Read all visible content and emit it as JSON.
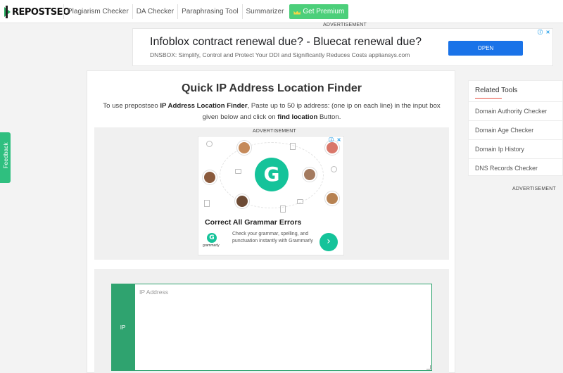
{
  "header": {
    "logo_text": "REPOSTSEO",
    "nav": [
      "Plagiarism Checker",
      "DA Checker",
      "Paraphrasing Tool",
      "Summarizer"
    ],
    "premium_label": "Get Premium"
  },
  "top_ad": {
    "label": "ADVERTISEMENT",
    "title": "Infoblox contract renewal due? - Bluecat renewal due?",
    "description": "DNSBOX: Simplify, Control and Protect Your DDI and Significantly Reduces Costs appliansys.com",
    "button": "OPEN",
    "button_color": "#1a73e8"
  },
  "main": {
    "title": "Quick IP Address Location Finder",
    "desc_1": "To use prepostseo ",
    "desc_bold_1": "IP Address Location Finder",
    "desc_2": ", Paste up to 50 ip address: (one ip on each line) in the input box given below and click on ",
    "desc_bold_2": "find location",
    "desc_3": " Button."
  },
  "mid_ad": {
    "label": "ADVERTISEMENT",
    "headline": "Correct All Grammar Errors",
    "logo_letter": "G",
    "brand": "grammarly",
    "text": "Check your grammar, spelling, and punctuation instantly with Grammarly",
    "accent": "#15c39a"
  },
  "tool": {
    "input_label": "IP",
    "placeholder": "IP Address",
    "accent": "#2fa36f"
  },
  "feedback": {
    "label": "Feedback"
  },
  "sidebar": {
    "title": "Related Tools",
    "items": [
      "Domain Authority Checker",
      "Domain Age Checker",
      "Domain Ip History",
      "DNS Records Checker"
    ],
    "ad_label": "ADVERTISEMENT"
  }
}
